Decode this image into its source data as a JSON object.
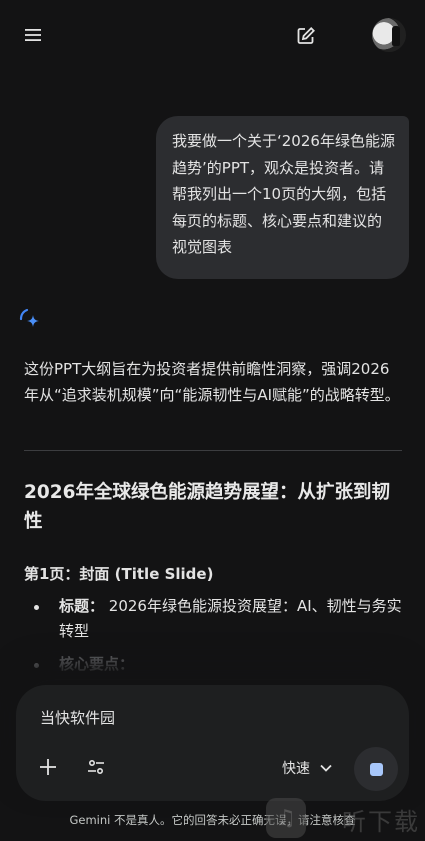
{
  "user_message": "我要做一个关于‘2026年绿色能源趋势’的PPT，观众是投资者。请帮我列出一个10页的大纲，包括每页的标题、核心要点和建议的视觉图表",
  "response": {
    "intro": "这份PPT大纲旨在为投资者提供前瞻性洞察，强调2026年从“追求装机规模”向“能源韧性与AI赋能”的战略转型。",
    "heading": "2026年全球绿色能源趋势展望：从扩张到韧性",
    "page1_title": "第1页：封面 (Title Slide)",
    "bullets": [
      {
        "label": "标题：",
        "text": "2026年绿色能源投资展望：AI、韧性与务实转型"
      },
      {
        "label": "核心要点：",
        "text": ""
      }
    ]
  },
  "composer": {
    "input_value": "当快软件园",
    "mode_label": "快速"
  },
  "disclaimer": "Gemini 不是真人。它的回答未必正确无误，请注意核查",
  "watermark": "听下载",
  "colors": {
    "background": "#131314",
    "bubble": "#2c2d30",
    "composer": "#1e1f20",
    "accent": "#a8c7fa",
    "spark_blue": "#4285f4"
  },
  "icons": {
    "menu": "hamburger-menu-icon",
    "new_chat": "edit-pencil-icon",
    "spark": "gemini-spark-icon",
    "plus": "plus-icon",
    "tools": "tune-sliders-icon",
    "chevron": "chevron-down-icon",
    "stop": "stop-square-icon"
  }
}
